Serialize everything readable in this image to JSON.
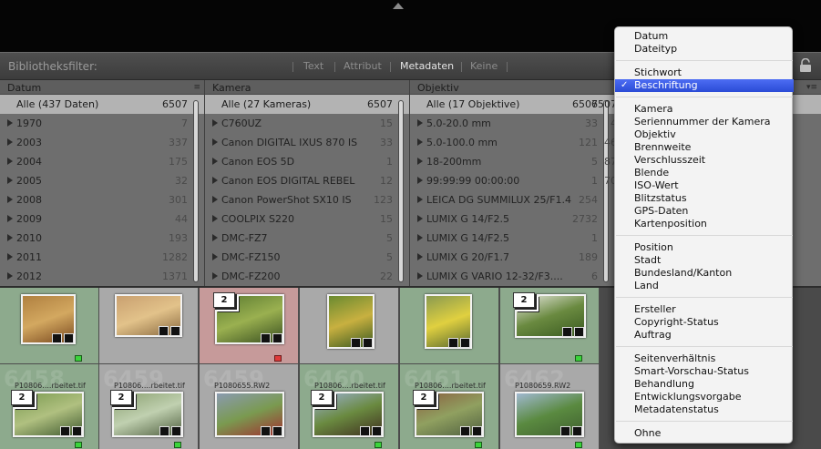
{
  "filter_bar": {
    "title": "Bibliotheksfilter:",
    "modes": [
      "Text",
      "Attribut",
      "Metadaten",
      "Keine"
    ],
    "active_mode": "Metadaten"
  },
  "columns": [
    {
      "header": "Datum",
      "rows": [
        {
          "label": "Alle (437 Daten)",
          "count": "6507",
          "selected": true
        },
        {
          "label": "1970",
          "count": "7"
        },
        {
          "label": "2003",
          "count": "337"
        },
        {
          "label": "2004",
          "count": "175"
        },
        {
          "label": "2005",
          "count": "32"
        },
        {
          "label": "2008",
          "count": "301"
        },
        {
          "label": "2009",
          "count": "44"
        },
        {
          "label": "2010",
          "count": "193"
        },
        {
          "label": "2011",
          "count": "1282"
        },
        {
          "label": "2012",
          "count": "1371"
        }
      ]
    },
    {
      "header": "Kamera",
      "rows": [
        {
          "label": "Alle (27 Kameras)",
          "count": "6507",
          "selected": true
        },
        {
          "label": "C760UZ",
          "count": "15"
        },
        {
          "label": "Canon DIGITAL IXUS 870 IS",
          "count": "33"
        },
        {
          "label": "Canon EOS 5D",
          "count": "1"
        },
        {
          "label": "Canon EOS DIGITAL REBEL",
          "count": "12"
        },
        {
          "label": "Canon PowerShot SX10 IS",
          "count": "123"
        },
        {
          "label": "COOLPIX S220",
          "count": "15"
        },
        {
          "label": "DMC-FZ7",
          "count": "5"
        },
        {
          "label": "DMC-FZ150",
          "count": "5"
        },
        {
          "label": "DMC-FZ200",
          "count": "22"
        }
      ]
    },
    {
      "header": "Objektiv",
      "rows": [
        {
          "label": "Alle (17 Objektive)",
          "count": "6507",
          "selected": true
        },
        {
          "label": "5.0-20.0 mm",
          "count": "33"
        },
        {
          "label": "5.0-100.0 mm",
          "count": "121"
        },
        {
          "label": "18-200mm",
          "count": "5"
        },
        {
          "label": "99:99:99 00:00:00",
          "count": "1"
        },
        {
          "label": "LEICA DG SUMMILUX 25/F1.4",
          "count": "254"
        },
        {
          "label": "LUMIX G 14/F2.5",
          "count": "2732"
        },
        {
          "label": "LUMIX G 14/F2.5",
          "count": "1"
        },
        {
          "label": "LUMIX G 20/F1.7",
          "count": "189"
        },
        {
          "label": "LUMIX G VARIO 12-32/F3....",
          "count": "6"
        }
      ]
    },
    {
      "header": "",
      "rows": [
        {
          "label": "",
          "count": "6507",
          "selected": true
        },
        {
          "label": "",
          "count": "4"
        },
        {
          "label": "",
          "count": "46"
        },
        {
          "label": "",
          "count": "87"
        },
        {
          "label": "",
          "count": "70"
        }
      ]
    }
  ],
  "grid": {
    "row1": [
      {
        "color": "green",
        "bignum": "",
        "fname": "",
        "stack": "",
        "flag": "green"
      },
      {
        "color": "gray",
        "bignum": "",
        "fname": "",
        "stack": "",
        "flag": ""
      },
      {
        "color": "red",
        "bignum": "",
        "fname": "",
        "stack": "2",
        "flag": "red"
      },
      {
        "color": "gray",
        "bignum": "",
        "fname": "",
        "stack": "",
        "flag": ""
      },
      {
        "color": "green",
        "bignum": "",
        "fname": "",
        "stack": "",
        "flag": ""
      },
      {
        "color": "green",
        "bignum": "",
        "fname": "",
        "stack": "2",
        "flag": "green"
      }
    ],
    "row2": [
      {
        "color": "green",
        "bignum": "6458",
        "fname": "P10806....rbeitet.tif",
        "stack": "2",
        "flag": "green"
      },
      {
        "color": "gray",
        "bignum": "6459",
        "fname": "P10806....rbeitet.tif",
        "stack": "2",
        "flag": "green"
      },
      {
        "color": "gray",
        "bignum": "6459",
        "fname": "P1080655.RW2",
        "stack": "",
        "flag": ""
      },
      {
        "color": "green",
        "bignum": "6460",
        "fname": "P10806....rbeitet.tif",
        "stack": "2",
        "flag": "green"
      },
      {
        "color": "green",
        "bignum": "6461",
        "fname": "P10806....rbeitet.tif",
        "stack": "2",
        "flag": "green"
      },
      {
        "color": "gray",
        "bignum": "6462",
        "fname": "P1080659.RW2",
        "stack": "",
        "flag": "green"
      }
    ]
  },
  "dropdown_menu": {
    "groups": [
      [
        "Datum",
        "Dateityp"
      ],
      [
        "Stichwort",
        "Beschriftung"
      ],
      [
        "Kamera",
        "Seriennummer der Kamera",
        "Objektiv",
        "Brennweite",
        "Verschlusszeit",
        "Blende",
        "ISO-Wert",
        "Blitzstatus",
        "GPS-Daten",
        "Kartenposition"
      ],
      [
        "Position",
        "Stadt",
        "Bundesland/Kanton",
        "Land"
      ],
      [
        "Ersteller",
        "Copyright-Status",
        "Auftrag"
      ],
      [
        "Seitenverhältnis",
        "Smart-Vorschau-Status",
        "Behandlung",
        "Entwicklungsvorgabe",
        "Metadatenstatus"
      ],
      [
        "Ohne"
      ]
    ],
    "checked_item": "Beschriftung",
    "highlighted_item": "Beschriftung",
    "check_glyph": "✓"
  },
  "colors": {
    "highlight": "#3a5ce6",
    "flag_green": "#3bd43b",
    "flag_red": "#e03a3a",
    "cell_green": "#8daa8d",
    "cell_red": "#c69a9a"
  }
}
